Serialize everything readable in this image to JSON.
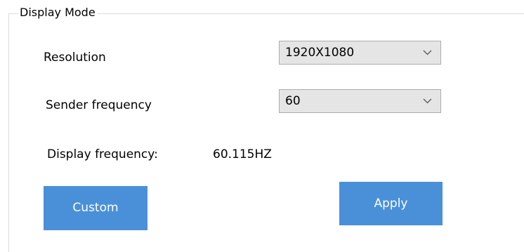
{
  "display_mode": {
    "title": "Display Mode",
    "resolution": {
      "label": "Resolution",
      "selected": "1920X1080"
    },
    "sender_frequency": {
      "label": "Sender frequency",
      "selected": "60"
    },
    "display_frequency": {
      "label": "Display frequency:",
      "value": "60.115HZ"
    },
    "buttons": {
      "custom": "Custom",
      "apply": "Apply"
    },
    "colors": {
      "button_bg": "#4a90d9",
      "select_bg": "#e5e5e5",
      "select_border": "#adadad"
    },
    "icons": {
      "dropdown": "chevron-down-icon"
    }
  }
}
